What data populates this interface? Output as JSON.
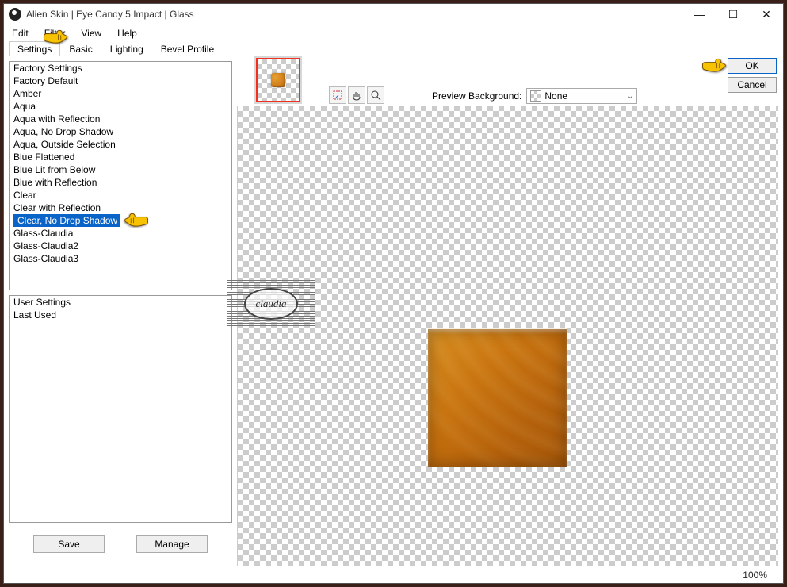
{
  "title": "Alien Skin | Eye Candy 5 Impact | Glass",
  "menu": {
    "edit": "Edit",
    "filter": "Filter",
    "view": "View",
    "help": "Help"
  },
  "tabs": {
    "settings": "Settings",
    "basic": "Basic",
    "lighting": "Lighting",
    "bevel": "Bevel Profile"
  },
  "factory": {
    "header": "Factory Settings",
    "items": [
      "Factory Default",
      "Amber",
      "Aqua",
      "Aqua with Reflection",
      "Aqua, No Drop Shadow",
      "Aqua, Outside Selection",
      "Blue Flattened",
      "Blue Lit from Below",
      "Blue with Reflection",
      "Clear",
      "Clear with Reflection",
      "Clear, No Drop Shadow",
      "Glass-Claudia",
      "Glass-Claudia2",
      "Glass-Claudia3"
    ],
    "selected_index": 11
  },
  "user": {
    "header": "User Settings",
    "items": [
      "Last Used"
    ]
  },
  "buttons": {
    "save": "Save",
    "manage": "Manage",
    "ok": "OK",
    "cancel": "Cancel"
  },
  "preview_bg": {
    "label": "Preview Background:",
    "value": "None"
  },
  "status": {
    "zoom": "100%"
  },
  "watermark": "claudia",
  "winctl": {
    "min": "—",
    "max": "☐",
    "close": "✕"
  }
}
